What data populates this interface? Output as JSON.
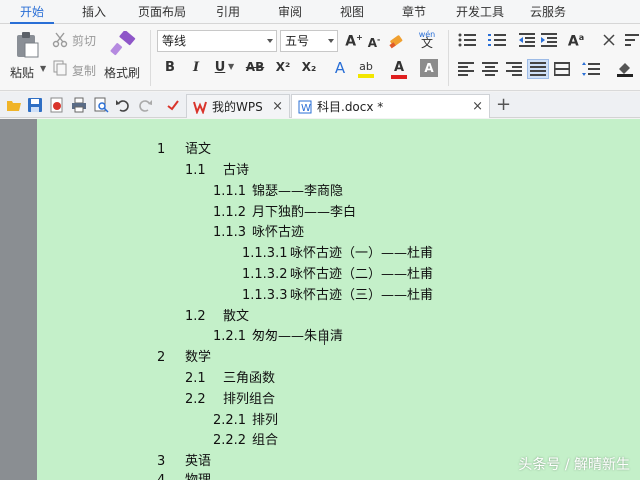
{
  "ribbon_tabs": [
    "开始",
    "插入",
    "页面布局",
    "引用",
    "审阅",
    "视图",
    "章节",
    "开发工具",
    "云服务"
  ],
  "clipboard": {
    "paste": "粘贴",
    "cut": "剪切",
    "copy": "复制",
    "format_painter": "格式刷"
  },
  "font": {
    "name": "等线",
    "size": "五号",
    "wen": "wén",
    "wen_char": "文"
  },
  "formatting": {
    "bold": "B",
    "italic": "I",
    "underline": "U",
    "strikethrough": "AB",
    "superscript": "X²",
    "subscript": "X₂",
    "highlight": "ab",
    "font_color": "A",
    "shade": "A",
    "grow_font": "A",
    "shrink_font": "A",
    "styles": "A"
  },
  "doc_tabs": [
    {
      "label": "我的WPS",
      "close": "×"
    },
    {
      "label": "科目.docx *",
      "close": "×"
    }
  ],
  "new_tab": "+",
  "outline": [
    {
      "num": "1",
      "text": "语文"
    },
    {
      "num": "1.1",
      "text": "古诗"
    },
    {
      "num": "1.1.1",
      "text": "锦瑟——李商隐"
    },
    {
      "num": "1.1.2",
      "text": "月下独酌——李白"
    },
    {
      "num": "1.1.3",
      "text": "咏怀古迹"
    },
    {
      "num": "1.1.3.1",
      "text": "咏怀古迹（一）——杜甫"
    },
    {
      "num": "1.1.3.2",
      "text": "咏怀古迹（二）——杜甫"
    },
    {
      "num": "1.1.3.3",
      "text": "咏怀古迹（三）——杜甫"
    },
    {
      "num": "1.2",
      "text": "散文"
    },
    {
      "num": "1.2.1",
      "text": "匆匆——朱自清"
    },
    {
      "num": "2",
      "text": "数学"
    },
    {
      "num": "2.1",
      "text": "三角函数"
    },
    {
      "num": "2.2",
      "text": "排列组合"
    },
    {
      "num": "2.2.1",
      "text": "排列"
    },
    {
      "num": "2.2.2",
      "text": "组合"
    },
    {
      "num": "3",
      "text": "英语"
    },
    {
      "num": "4",
      "text": "物理"
    }
  ],
  "watermark": "头条号 / 解晴新生",
  "colors": {
    "accent": "#2a6fd6",
    "page_bg": "#c4f0c9",
    "wps_red": "#d9342b"
  }
}
